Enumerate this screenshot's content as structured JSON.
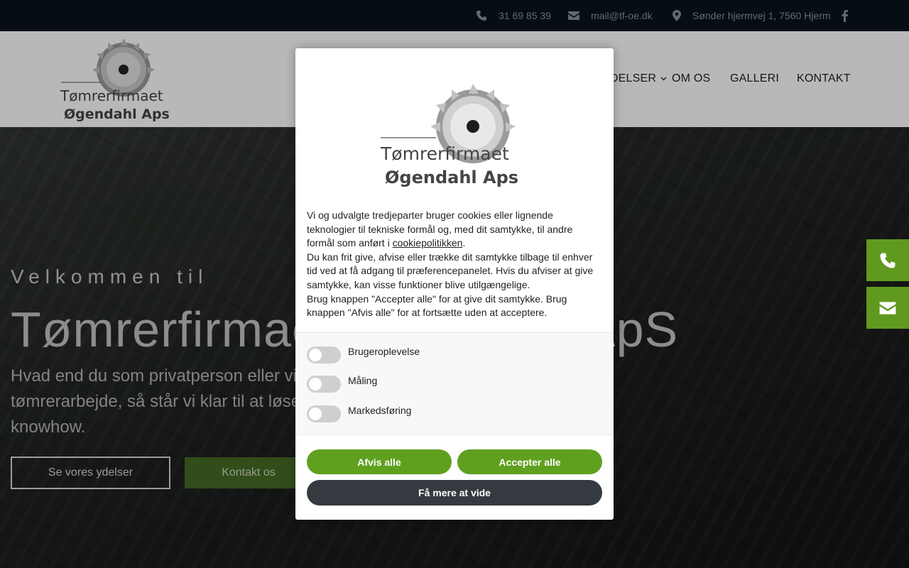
{
  "topbar": {
    "phone": "31 69 85 39",
    "email": "mail@tf-oe.dk",
    "address": "Sønder hjermvej 1, 7560 Hjerm"
  },
  "logo": {
    "line1": "Tømrerfirmaet",
    "line2": "Øgendahl Aps"
  },
  "nav": {
    "items": [
      {
        "label": "YDELSER"
      },
      {
        "label": "OM OS"
      },
      {
        "label": "GALLERI"
      },
      {
        "label": "KONTAKT"
      }
    ]
  },
  "hero": {
    "pre_title": "Velkommen til",
    "title": "Tømrerfirmaet Øgendahl ApS",
    "text": "Hvad end du som privatperson eller virksomhed ønsker at få have udført tømrerarbejde, så står vi klar til at løse opgaven med faglig ekspertise og knowhow.",
    "btn_services": "Se vores ydelser",
    "btn_contact": "Kontakt os"
  },
  "cookie": {
    "text_part1": "Vi og udvalgte tredjeparter bruger cookies eller lignende teknologier til tekniske formål og, med dit samtykke, til andre formål som anført i ",
    "link": "cookiepolitikken",
    "text_part2": ".",
    "text_p2": "Du kan frit give, afvise eller trække dit samtykke tilbage til enhver tid ved at få adgang til præferencepanelet. Hvis du afviser at give samtykke, kan visse funktioner blive utilgængelige.",
    "text_p3": "Brug knappen \"Accepter alle\" for at give dit samtykke. Brug knappen \"Afvis alle\" for at fortsætte uden at acceptere.",
    "toggles": [
      {
        "label": "Brugeroplevelse",
        "on": false
      },
      {
        "label": "Måling",
        "on": false
      },
      {
        "label": "Markedsføring",
        "on": false
      }
    ],
    "btn_reject": "Afvis alle",
    "btn_accept": "Accepter alle",
    "btn_more": "Få mere at vide"
  },
  "colors": {
    "accent_green": "#60a01f",
    "dark_button": "#343a40",
    "topbar_bg": "#0b121c"
  }
}
